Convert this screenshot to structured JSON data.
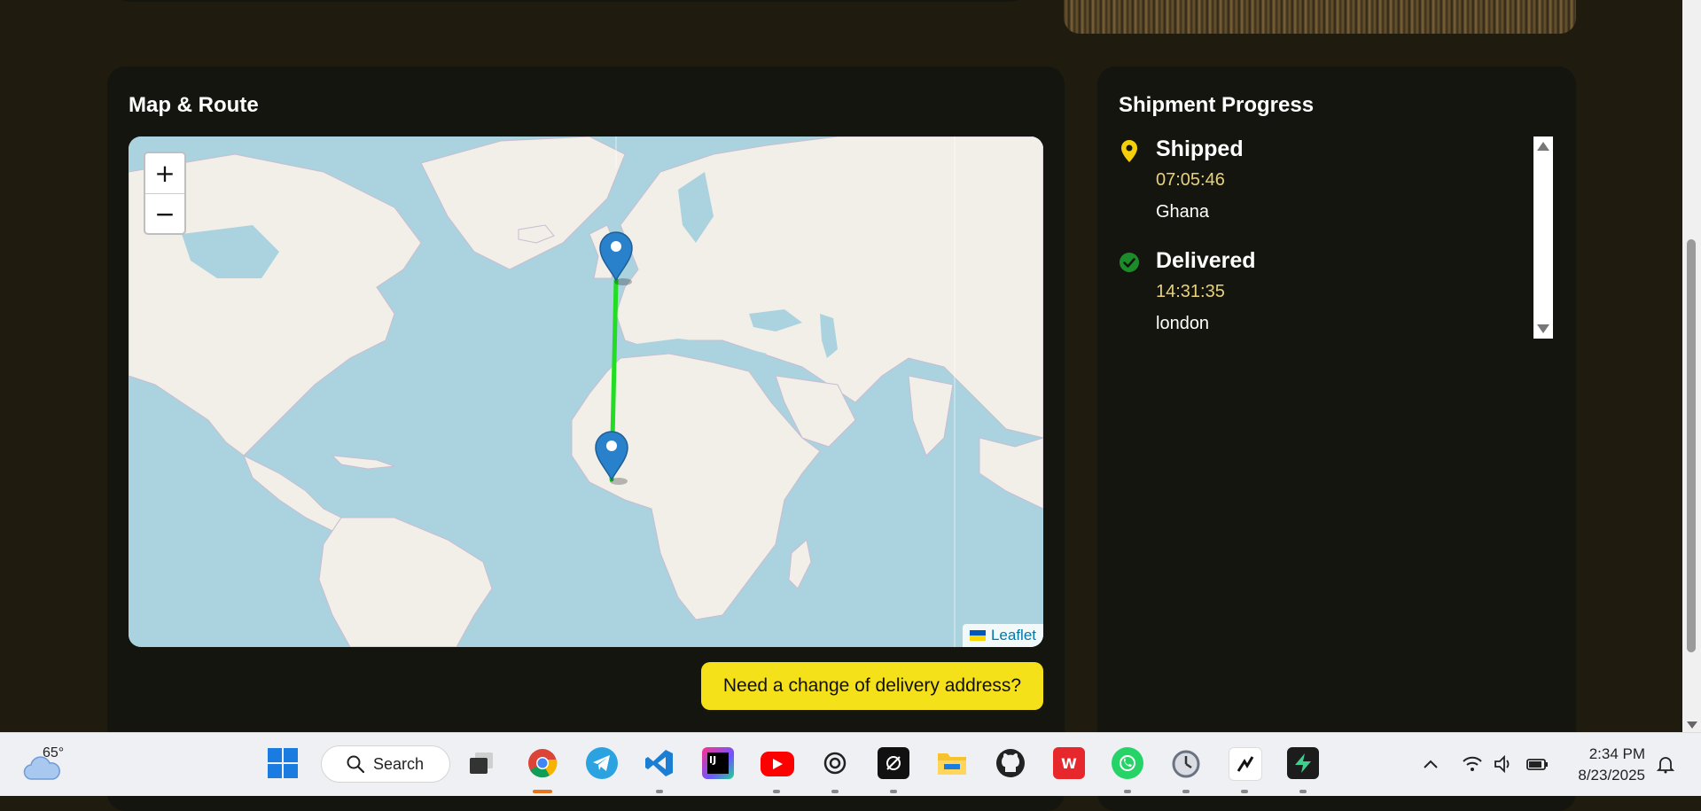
{
  "map_card": {
    "title": "Map & Route",
    "zoom_in": "+",
    "zoom_out": "−",
    "attribution": "Leaflet",
    "cta": "Need a change of delivery address?",
    "route_color": "#22dd22",
    "marker_color": "#2a81cb"
  },
  "progress_card": {
    "title": "Shipment Progress",
    "events": [
      {
        "status": "Shipped",
        "time": "07:05:46",
        "place": "Ghana",
        "icon": "location-pin-icon",
        "icon_color": "#f5d00a"
      },
      {
        "status": "Delivered",
        "time": "14:31:35",
        "place": "london",
        "icon": "check-circle-icon",
        "icon_color": "#1c8c2a"
      }
    ]
  },
  "taskbar": {
    "weather_temp": "65°",
    "search_label": "Search",
    "time": "2:34 PM",
    "date": "8/23/2025",
    "apps": [
      "Start",
      "Task View",
      "Chrome",
      "Telegram",
      "VS Code",
      "JetBrains",
      "YouTube",
      "ChatGPT",
      "Cursor",
      "File Explorer",
      "GitHub",
      "WPS",
      "WhatsApp",
      "Clock",
      "Terminal App",
      "Supabase"
    ]
  },
  "colors": {
    "page_bg": "#1f1c0f",
    "card_bg": "#151510",
    "accent_yellow": "#f5e11a",
    "time_color": "#e6d27a"
  }
}
